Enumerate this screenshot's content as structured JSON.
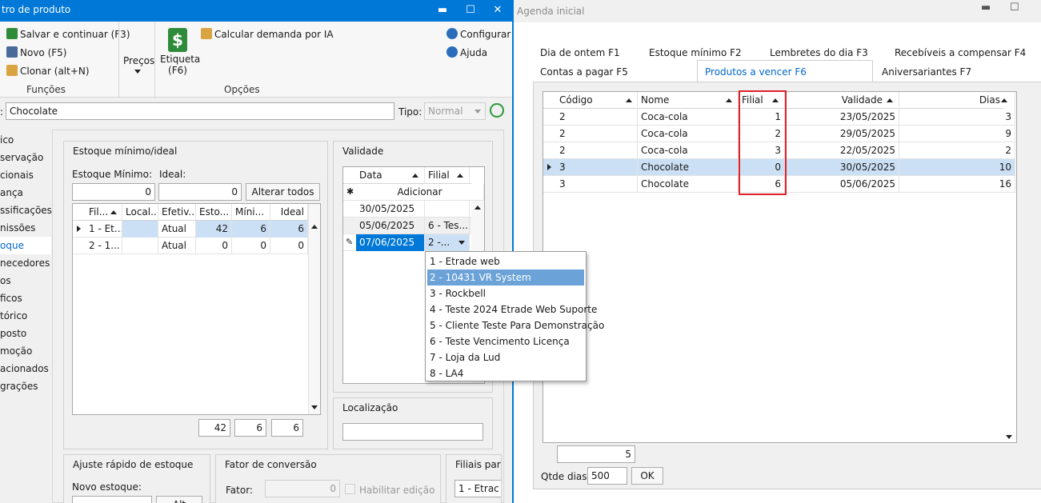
{
  "left_window": {
    "title": "tro de produto",
    "controls": [
      "▬",
      "☐",
      "✕"
    ],
    "ribbon": {
      "funcoes": {
        "salvar": "Salvar e continuar (F3)",
        "novo": "Novo (F5)",
        "clonar": "Clonar (alt+N)",
        "label": "Funções"
      },
      "precos": "Preços",
      "opcoes": {
        "etiqueta": "Etiqueta",
        "etiqueta_key": "(F6)",
        "calcular": "Calcular demanda por IA",
        "label": "Opções"
      },
      "configurar": "Configurar",
      "ajuda": "Ajuda"
    },
    "name_field_value": "Chocolate",
    "tipo_label": "Tipo:",
    "tipo_value": "Normal",
    "sidebar": [
      "ico",
      "servação",
      "cionais",
      "ança",
      "ssificações",
      "nissões",
      "oque",
      "necedores",
      "os",
      "ficos",
      "tórico",
      "posto",
      "moção",
      "acionados",
      "grações"
    ],
    "estoque": {
      "title": "Estoque mínimo/ideal",
      "min_label": "Estoque Mínimo:",
      "ideal_label": "Ideal:",
      "min_value": "0",
      "ideal_value": "0",
      "alterar_button": "Alterar todos",
      "columns": [
        "Fil...",
        "Local...",
        "Efetiv...",
        "Esto...",
        "Míni...",
        "Ideal"
      ],
      "rows": [
        [
          "1 - Et...",
          "",
          "Atual",
          "42",
          "6",
          "6"
        ],
        [
          "2 - 1...",
          "",
          "Atual",
          "0",
          "0",
          "0"
        ]
      ],
      "totals": [
        "42",
        "6",
        "6"
      ]
    },
    "validade": {
      "title": "Validade",
      "columns": [
        "Data",
        "Filial"
      ],
      "add_label": "Adicionar",
      "rows": [
        [
          "30/05/2025",
          ""
        ],
        [
          "05/06/2025",
          "6 - Tes..."
        ],
        [
          "07/06/2025",
          "2 -..."
        ]
      ]
    },
    "filial_dropdown": [
      "1 - Etrade web",
      "2 - 10431 VR System",
      "3 - Rockbell",
      "4 - Teste 2024 Etrade Web Suporte",
      "5 - Cliente Teste Para Demonstração",
      "6 - Teste Vencimento Licença",
      "7 - Loja da Lud",
      "8 - LA4"
    ],
    "localizacao_title": "Localização",
    "ajuste": {
      "title": "Ajuste rápido de estoque",
      "novo_label": "Novo estoque:",
      "alt_button": "Alt"
    },
    "fator": {
      "title": "Fator de conversão",
      "fator_label": "Fator:",
      "fator_value": "0",
      "habilitar": "Habilitar edição"
    },
    "filiais": {
      "title": "Filiais par",
      "value": "1 - Etrac"
    }
  },
  "right_window": {
    "title": "Agenda inicial",
    "controls": [
      "▬",
      "☐"
    ],
    "tabs_row1": [
      "Dia de ontem F1",
      "Estoque mínimo F2",
      "Lembretes do dia F3",
      "Recebíveis a compensar F4"
    ],
    "tabs_row2": [
      "Contas a pagar F5",
      "Produtos a vencer F6",
      "Aniversariantes F7"
    ],
    "grid": {
      "columns": [
        "Código",
        "Nome",
        "Filial",
        "Validade",
        "Dias"
      ],
      "rows": [
        [
          "2",
          "Coca-cola",
          "1",
          "23/05/2025",
          "3"
        ],
        [
          "2",
          "Coca-cola",
          "2",
          "29/05/2025",
          "9"
        ],
        [
          "2",
          "Coca-cola",
          "3",
          "22/05/2025",
          "2"
        ],
        [
          "3",
          "Chocolate",
          "0",
          "30/05/2025",
          "10"
        ],
        [
          "3",
          "Chocolate",
          "6",
          "05/06/2025",
          "16"
        ]
      ],
      "count": "5"
    },
    "qtde_label": "Qtde dias:",
    "qtde_value": "500",
    "ok_button": "OK"
  },
  "colors": {
    "titlebar": "#0078d7",
    "selection": "#cce0f5",
    "dropdown_highlight": "#6ba3d8",
    "highlight_box": "#e0202a",
    "active_tab": "#0066cc"
  }
}
